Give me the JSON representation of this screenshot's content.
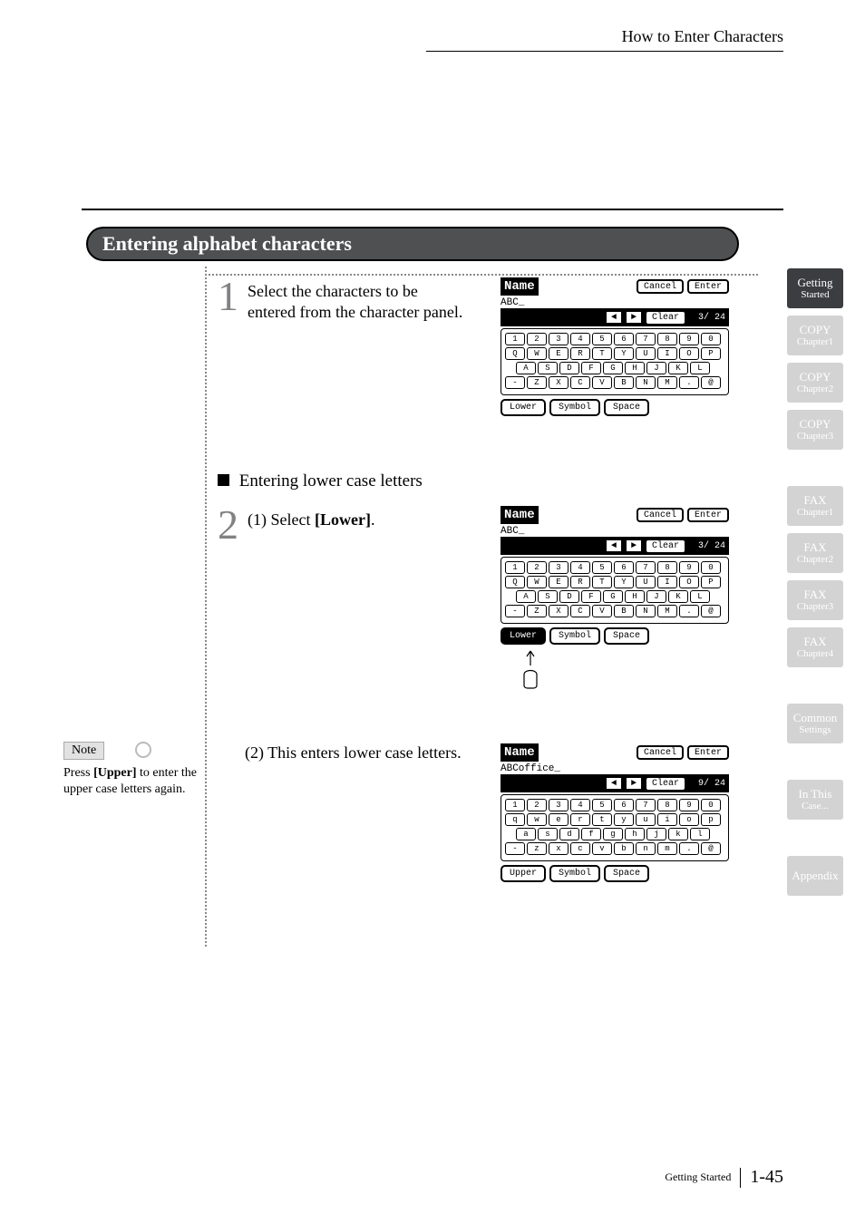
{
  "header": {
    "section": "How to Enter Characters"
  },
  "title": "Entering alphabet characters",
  "steps": {
    "s1_num": "1",
    "s1_text": "Select the characters to be entered from the character panel.",
    "subhead": "Entering lower case letters",
    "s2_num": "2",
    "s2a_pre": "(1) Select ",
    "s2a_bold": "[Lower]",
    "s2a_post": ".",
    "s2b": "(2) This enters lower case letters."
  },
  "note": {
    "label": "Note",
    "text_pre": "Press ",
    "text_bold": "[Upper]",
    "text_post": " to enter the upper case letters again."
  },
  "panels": {
    "common": {
      "title": "Name",
      "cancel": "Cancel",
      "enter": "Enter",
      "clear": "Clear",
      "symbol": "Symbol",
      "space": "Space",
      "arrow_l": "◄",
      "arrow_r": "►"
    },
    "p1": {
      "input": "ABC_",
      "counter": "3/ 24",
      "rows": [
        [
          "1",
          "2",
          "3",
          "4",
          "5",
          "6",
          "7",
          "8",
          "9",
          "0"
        ],
        [
          "Q",
          "W",
          "E",
          "R",
          "T",
          "Y",
          "U",
          "I",
          "O",
          "P"
        ],
        [
          "A",
          "S",
          "D",
          "F",
          "G",
          "H",
          "J",
          "K",
          "L"
        ],
        [
          "-",
          "Z",
          "X",
          "C",
          "V",
          "B",
          "N",
          "M",
          ".",
          "@"
        ]
      ],
      "mode_left": "Lower"
    },
    "p2": {
      "input": "ABC_",
      "counter": "3/ 24",
      "rows": [
        [
          "1",
          "2",
          "3",
          "4",
          "5",
          "6",
          "7",
          "8",
          "9",
          "0"
        ],
        [
          "Q",
          "W",
          "E",
          "R",
          "T",
          "Y",
          "U",
          "I",
          "O",
          "P"
        ],
        [
          "A",
          "S",
          "D",
          "F",
          "G",
          "H",
          "J",
          "K",
          "L"
        ],
        [
          "-",
          "Z",
          "X",
          "C",
          "V",
          "B",
          "N",
          "M",
          ".",
          "@"
        ]
      ],
      "mode_left": "Lower",
      "mode_left_sel": true
    },
    "p3": {
      "input": "ABCoffice_",
      "counter": "9/ 24",
      "rows": [
        [
          "1",
          "2",
          "3",
          "4",
          "5",
          "6",
          "7",
          "8",
          "9",
          "0"
        ],
        [
          "q",
          "w",
          "e",
          "r",
          "t",
          "y",
          "u",
          "i",
          "o",
          "p"
        ],
        [
          "a",
          "s",
          "d",
          "f",
          "g",
          "h",
          "j",
          "k",
          "l"
        ],
        [
          "-",
          "z",
          "x",
          "c",
          "v",
          "b",
          "n",
          "m",
          ".",
          "@"
        ]
      ],
      "mode_left": "Upper"
    }
  },
  "tabs": [
    {
      "l1": "Getting",
      "l2": "Started",
      "active": true
    },
    {
      "l1": "COPY",
      "l2": "Chapter1"
    },
    {
      "l1": "COPY",
      "l2": "Chapter2"
    },
    {
      "l1": "COPY",
      "l2": "Chapter3"
    },
    {
      "gap": true
    },
    {
      "l1": "FAX",
      "l2": "Chapter1"
    },
    {
      "l1": "FAX",
      "l2": "Chapter2"
    },
    {
      "l1": "FAX",
      "l2": "Chapter3"
    },
    {
      "l1": "FAX",
      "l2": "Chapter4"
    },
    {
      "gap": true
    },
    {
      "l1": "Common",
      "l2": "Settings"
    },
    {
      "gap": true
    },
    {
      "l1": "In This",
      "l2": "Case..."
    },
    {
      "gap": true
    },
    {
      "l1": "Appendix",
      "l2": ""
    }
  ],
  "footer": {
    "section": "Getting Started",
    "page": "1-45"
  }
}
